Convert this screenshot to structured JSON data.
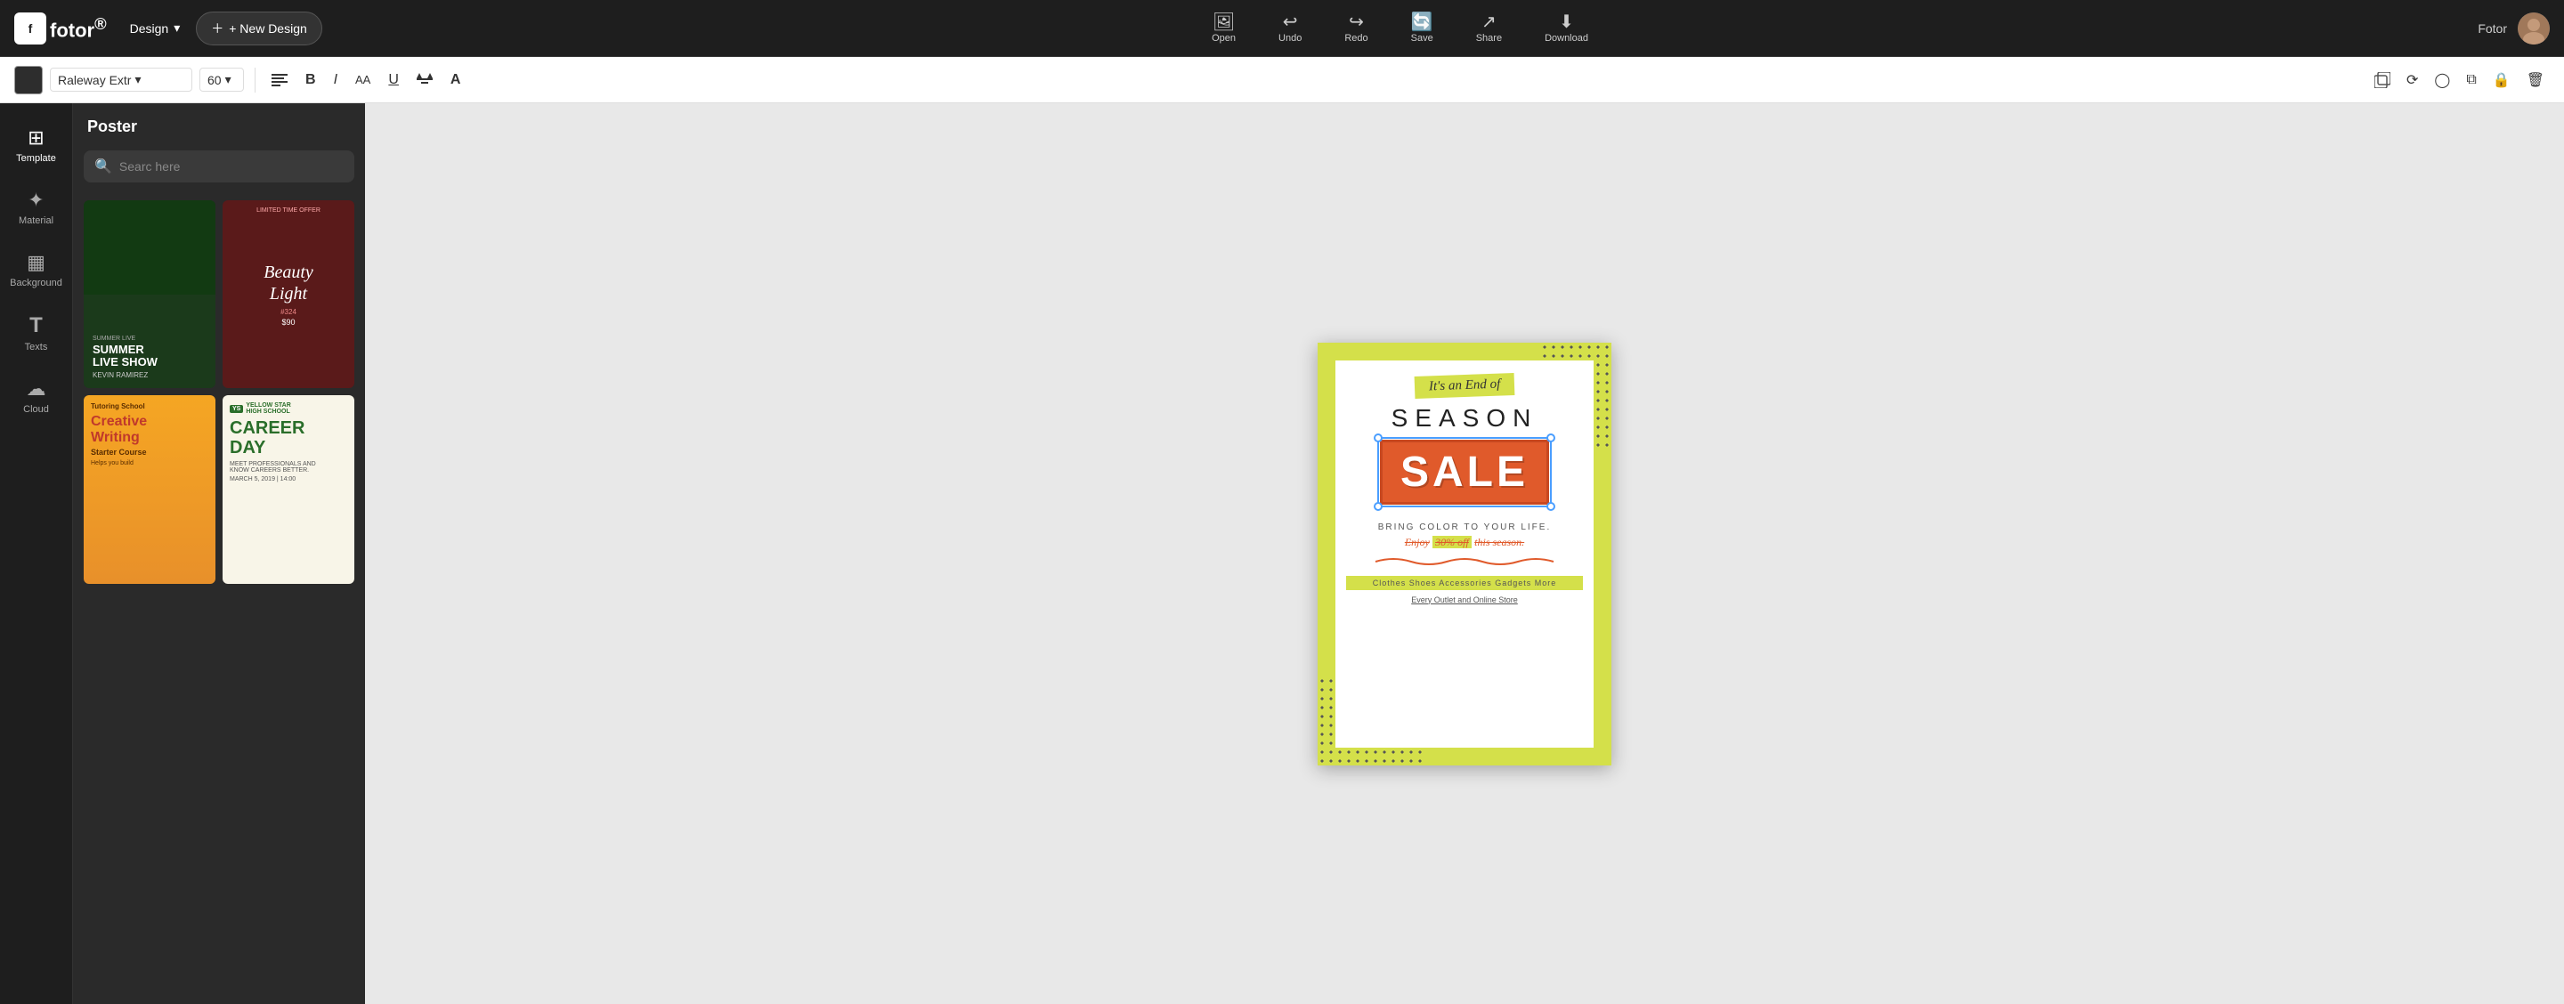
{
  "app": {
    "logo_text": "fotor",
    "logo_super": "®",
    "user_name": "Fotor"
  },
  "top_nav": {
    "design_label": "Design",
    "new_design_label": "+ New Design",
    "open_label": "Open",
    "undo_label": "Undo",
    "redo_label": "Redo",
    "save_label": "Save",
    "share_label": "Share",
    "download_label": "Download"
  },
  "toolbar": {
    "font_name": "Raleway Extr",
    "font_size": "60",
    "bold_label": "B",
    "italic_label": "I",
    "underline_label": "U"
  },
  "sidebar": {
    "items": [
      {
        "id": "template",
        "label": "Template",
        "icon": "⊞"
      },
      {
        "id": "material",
        "label": "Material",
        "icon": "✦"
      },
      {
        "id": "background",
        "label": "Background",
        "icon": "▦"
      },
      {
        "id": "texts",
        "label": "Texts",
        "icon": "T"
      },
      {
        "id": "cloud",
        "label": "Cloud",
        "icon": "☁"
      }
    ]
  },
  "panel": {
    "title": "Poster",
    "search_placeholder": "Searc here",
    "templates": [
      {
        "id": "t1",
        "type": "concert",
        "title": "SUMMER LIVE SHOW",
        "subtitle": "KEVIN RAMIREZ"
      },
      {
        "id": "t2",
        "type": "beauty",
        "title": "Beauty Light",
        "subtitle": "LIMITED TIME OFFER"
      },
      {
        "id": "t3",
        "type": "writing",
        "title": "Creative Writing",
        "subtitle": "Tutoring School"
      },
      {
        "id": "t4",
        "type": "career",
        "title": "CAREER DAY",
        "subtitle": "YELLOW STAR HIGH SCHOOL"
      }
    ]
  },
  "canvas": {
    "poster": {
      "end_of_season": "It's an End of",
      "season": "SEASON",
      "sale": "SALE",
      "bring": "BRING COLOR TO YOUR LIFE.",
      "enjoy": "Enjoy",
      "discount": "30% off",
      "this_season": "this season.",
      "categories": "Clothes  Shoes  Accessories  Gadgets  More",
      "outlet": "Every Outlet and Online Store"
    }
  },
  "colors": {
    "accent_yellow": "#d4e04a",
    "accent_red": "#e05a2b",
    "selection_blue": "#4a9eff",
    "dark_bg": "#1e1e1e",
    "panel_bg": "#2a2a2a"
  }
}
